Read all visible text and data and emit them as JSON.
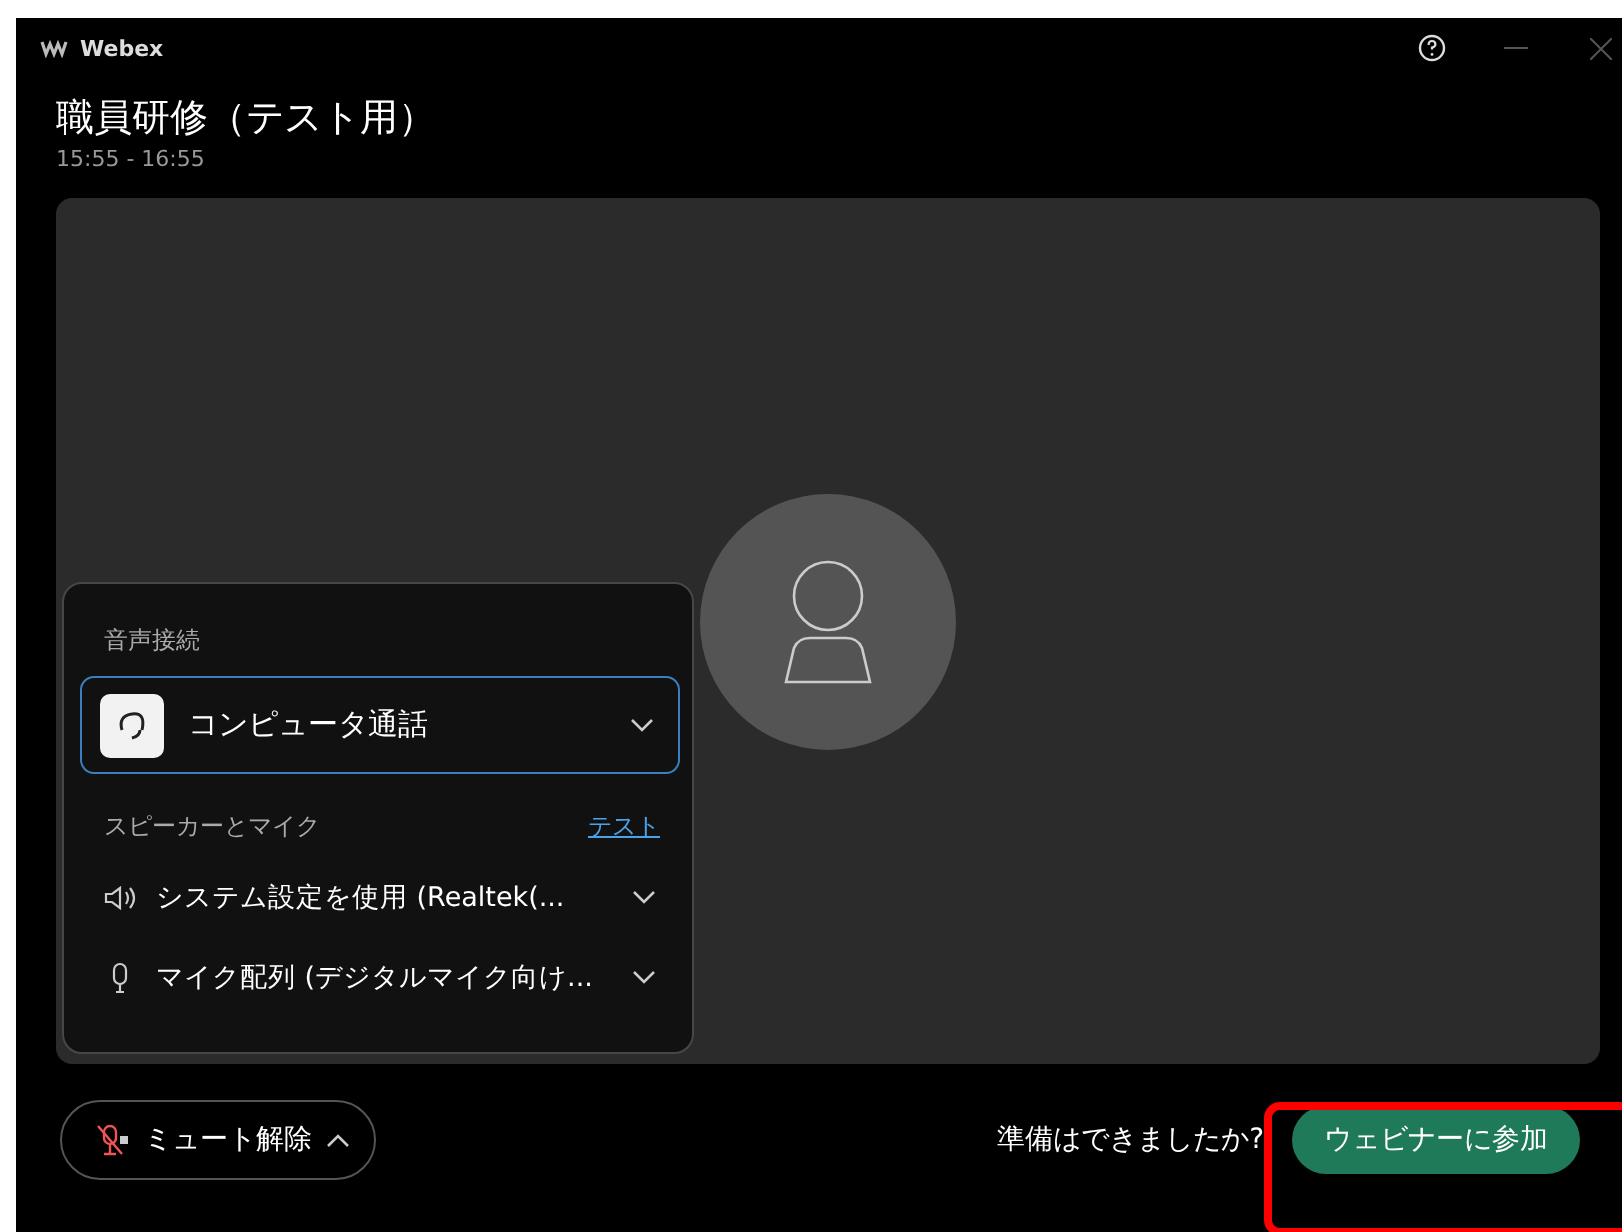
{
  "window": {
    "app": "Webex",
    "title": "職員研修（テスト用）",
    "time": "15:55 - 16:55"
  },
  "audio_panel": {
    "heading": "音声接続",
    "connection": "コンピュータ通話",
    "devices_heading": "スピーカーとマイク",
    "test_link": "テスト",
    "devices": [
      {
        "kind": "speaker",
        "label": "システム設定を使用 (Realtek(..."
      },
      {
        "kind": "microphone",
        "label": "マイク配列 (デジタルマイク向け..."
      }
    ]
  },
  "footer": {
    "mute_button": "ミュート解除",
    "prompt": "準備はできましたか?",
    "join_button": "ウェビナーに参加"
  }
}
